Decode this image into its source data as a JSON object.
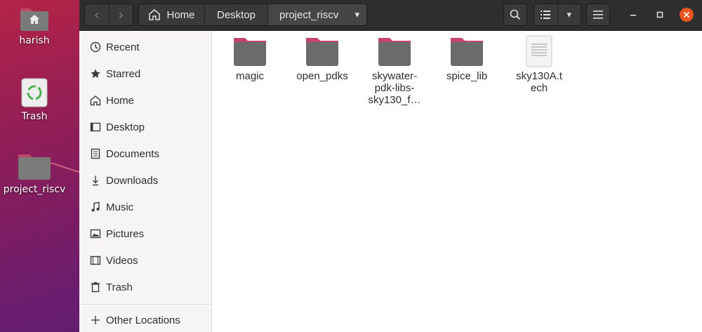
{
  "desktop": {
    "icons": [
      {
        "label": "harish",
        "icon": "home-folder-icon"
      },
      {
        "label": "Trash",
        "icon": "trash-icon"
      },
      {
        "label": "project_riscv",
        "icon": "folder-icon"
      }
    ]
  },
  "headerbar": {
    "back_icon": "‹",
    "forward_icon": "›",
    "breadcrumbs": [
      "Home",
      "Desktop",
      "project_riscv"
    ],
    "dropdown_icon": "▾"
  },
  "sidebar": {
    "items": [
      {
        "label": "Recent",
        "icon": "clock-icon"
      },
      {
        "label": "Starred",
        "icon": "star-icon"
      },
      {
        "label": "Home",
        "icon": "home-icon"
      },
      {
        "label": "Desktop",
        "icon": "desktop-icon"
      },
      {
        "label": "Documents",
        "icon": "document-icon"
      },
      {
        "label": "Downloads",
        "icon": "download-icon"
      },
      {
        "label": "Music",
        "icon": "music-icon"
      },
      {
        "label": "Pictures",
        "icon": "picture-icon"
      },
      {
        "label": "Videos",
        "icon": "video-icon"
      },
      {
        "label": "Trash",
        "icon": "trash-icon"
      }
    ],
    "other_locations": {
      "label": "Other Locations",
      "icon": "plus-icon"
    }
  },
  "files": [
    {
      "label": "magic",
      "type": "folder"
    },
    {
      "label": "open_pdks",
      "type": "folder"
    },
    {
      "label": "skywater-pdk-libs-sky130_f…",
      "type": "folder"
    },
    {
      "label": "spice_lib",
      "type": "folder"
    },
    {
      "label": "sky130A.tech",
      "type": "text-file"
    }
  ],
  "colors": {
    "folder_body": "#6b6b6b",
    "folder_tab": "#d94a4a",
    "headerbar": "#2e2e2e",
    "close_button": "#e95420"
  }
}
